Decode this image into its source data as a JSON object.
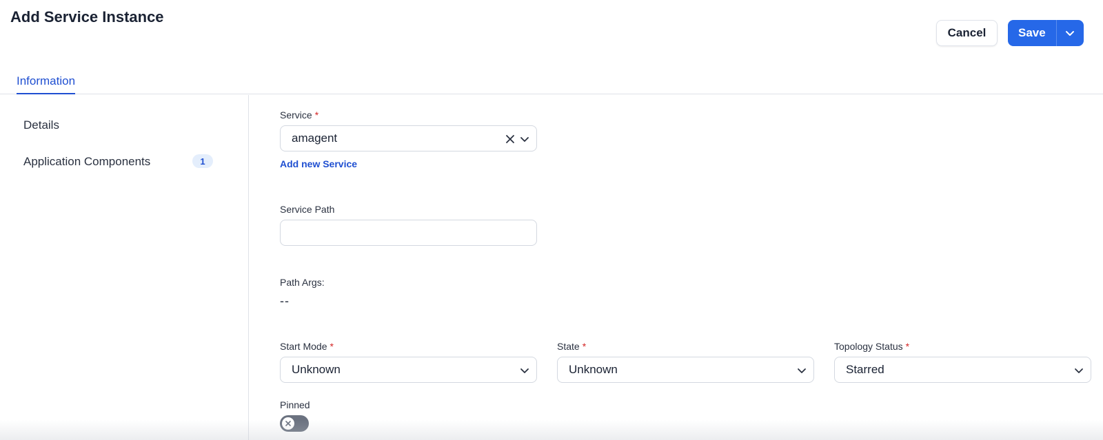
{
  "page": {
    "title": "Add Service Instance"
  },
  "header": {
    "cancel_label": "Cancel",
    "save_label": "Save"
  },
  "tabs": [
    {
      "label": "Information",
      "active": true
    }
  ],
  "sidebar": {
    "items": [
      {
        "label": "Details"
      },
      {
        "label": "Application Components",
        "badge": "1"
      }
    ]
  },
  "form": {
    "service": {
      "label": "Service",
      "required_mark": "*",
      "value": "amagent",
      "add_link": "Add new Service"
    },
    "service_path": {
      "label": "Service Path",
      "value": ""
    },
    "path_args": {
      "label": "Path Args:",
      "value": "--"
    },
    "start_mode": {
      "label": "Start Mode",
      "required_mark": "*",
      "value": "Unknown"
    },
    "state": {
      "label": "State",
      "required_mark": "*",
      "value": "Unknown"
    },
    "topology_status": {
      "label": "Topology Status",
      "required_mark": "*",
      "value": "Starred"
    },
    "pinned": {
      "label": "Pinned",
      "on": false
    }
  },
  "colors": {
    "accent": "#2668e8",
    "link": "#1f4fd1",
    "required": "#d42626",
    "toggle_off": "#6b7280"
  },
  "icons": {
    "clear": "close-icon",
    "dropdown": "chevron-down-icon",
    "toggle_off": "x-icon"
  }
}
